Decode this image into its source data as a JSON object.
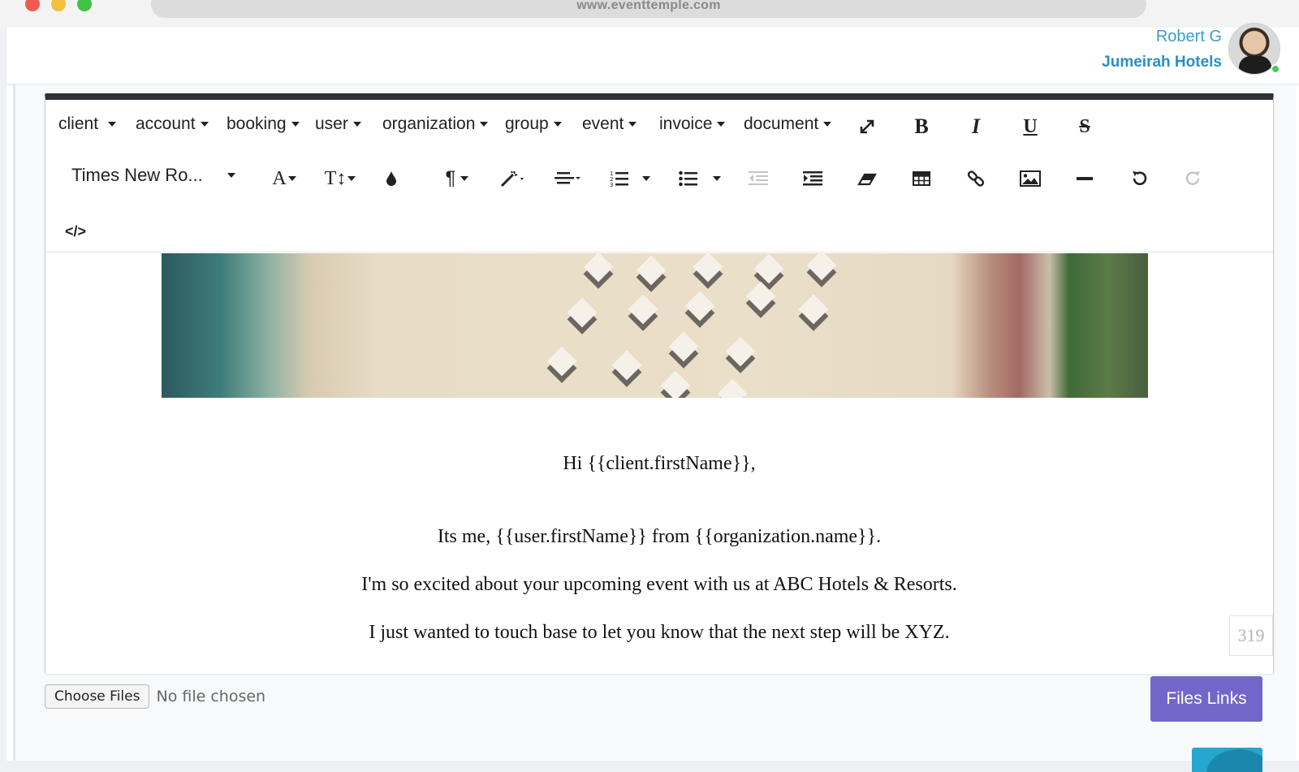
{
  "browser": {
    "url": "www.eventtemple.com"
  },
  "user": {
    "name": "Robert G",
    "organization": "Jumeirah Hotels",
    "status_color": "#3ccd5e"
  },
  "toolbar": {
    "merge_menus": [
      "client",
      "account",
      "booking",
      "user",
      "organization",
      "group",
      "event",
      "invoice",
      "document"
    ],
    "font_name": "Times New Ro..."
  },
  "editor": {
    "greeting": "Hi {{client.firstName}},",
    "line1": "Its me, {{user.firstName}} from {{organization.name}}.",
    "line2": "I'm so excited about your upcoming event with us at ABC Hotels & Resorts.",
    "line3": "I just wanted to touch base to let you know that the next step will be XYZ.",
    "counter": "319"
  },
  "files": {
    "choose_label": "Choose Files",
    "status": "No file chosen"
  },
  "actions": {
    "files_links": "Files Links"
  },
  "colors": {
    "accent_purple": "#7466c8",
    "link_blue": "#2a8ec7",
    "toolbar_top": "#2d3034"
  }
}
